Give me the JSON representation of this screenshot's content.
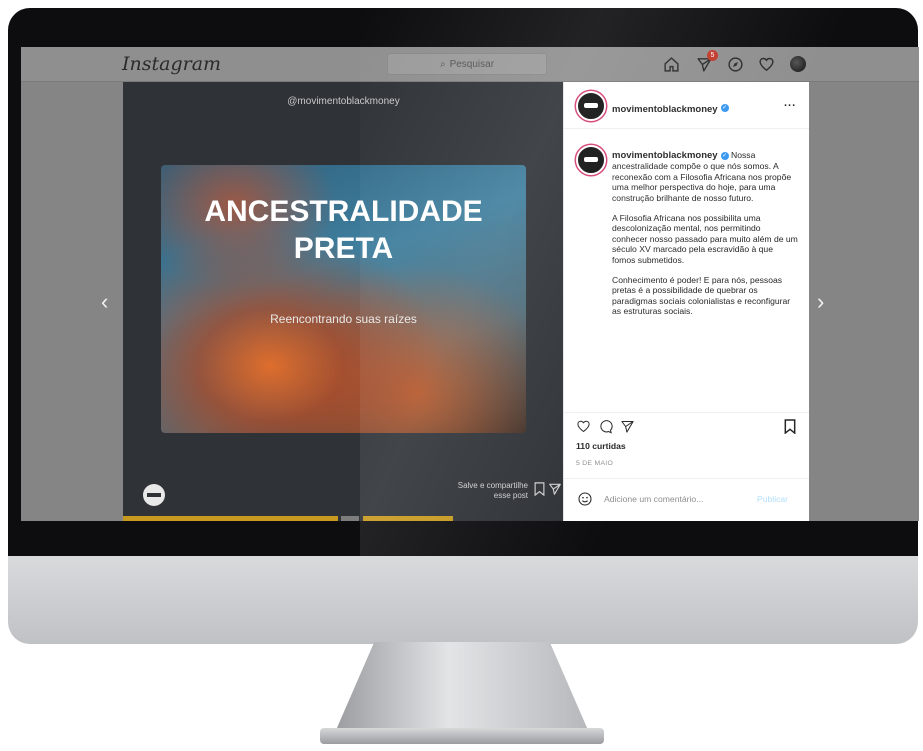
{
  "topbar": {
    "logo": "Instagram",
    "search_placeholder": "Pesquisar",
    "notification_count": "5",
    "icons": [
      "home-icon",
      "direct-icon",
      "explore-icon",
      "heart-icon",
      "profile-avatar"
    ]
  },
  "post_image": {
    "handle": "@movimentoblackmoney",
    "headline": "ANCESTRALIDADE PRETA",
    "subheadline": "Reencontrando suas raízes",
    "share_line1": "Salve e compartilhe",
    "share_line2": "esse post"
  },
  "panel": {
    "header_username": "movimentoblackmoney",
    "more_label": "...",
    "caption_username": "movimentoblackmoney",
    "caption_p1": "Nossa ancestralidade compõe o que nós somos. A reconexão com a Filosofia Africana nos propõe uma melhor perspectiva do hoje, para uma construção brilhante de nosso futuro.",
    "caption_p2": "A Filosofia Africana nos possibilita uma descolonização mental, nos permitindo conhecer nosso passado para muito além de um século XV marcado pela escravidão à que fomos submetidos.",
    "caption_p3": "Conhecimento é poder! E para nós, pessoas pretas é a possibilidade de quebrar os paradigmas sociais colonialistas e reconfigurar as estruturas sociais.",
    "likes": "110 curtidas",
    "date": "5 DE MAIO",
    "comment_placeholder": "Adicione um comentário...",
    "publish_label": "Publicar"
  },
  "navigation": {
    "prev_arrow": "‹",
    "next_arrow": "›"
  },
  "colors": {
    "accent_blue": "#3897f0",
    "story_ring": "#d43f6f",
    "progress": "#d4a017"
  }
}
